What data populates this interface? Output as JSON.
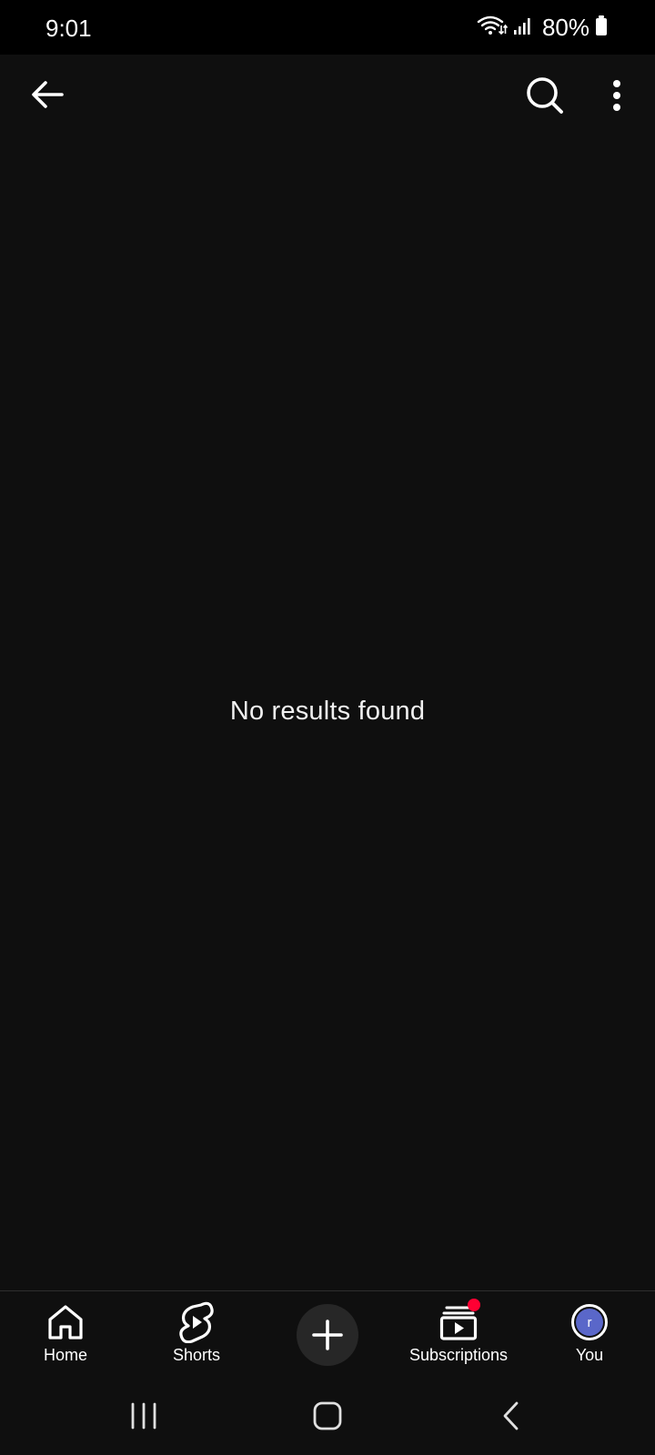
{
  "status_bar": {
    "time": "9:01",
    "battery_text": "80%",
    "icons": [
      "wifi-icon",
      "signal-icon",
      "battery-icon"
    ]
  },
  "app_bar": {
    "icons": [
      "back-arrow-icon",
      "search-icon",
      "more-vert-icon"
    ]
  },
  "main": {
    "empty_message": "No results found"
  },
  "bottom_nav": {
    "items": [
      {
        "label": "Home",
        "icon": "home-icon"
      },
      {
        "label": "Shorts",
        "icon": "shorts-icon"
      },
      {
        "label": "",
        "icon": "plus-icon"
      },
      {
        "label": "Subscriptions",
        "icon": "subscriptions-icon"
      },
      {
        "label": "You",
        "icon": "avatar"
      }
    ],
    "avatar_initial": "r"
  },
  "colors": {
    "background": "#0f0f0f",
    "status_bar": "#000000",
    "notification_dot": "#ff0033",
    "avatar": "#5a67c9",
    "create_button": "#272727"
  },
  "system_nav": {
    "icons": [
      "recents-icon",
      "home-button-icon",
      "system-back-icon"
    ]
  }
}
